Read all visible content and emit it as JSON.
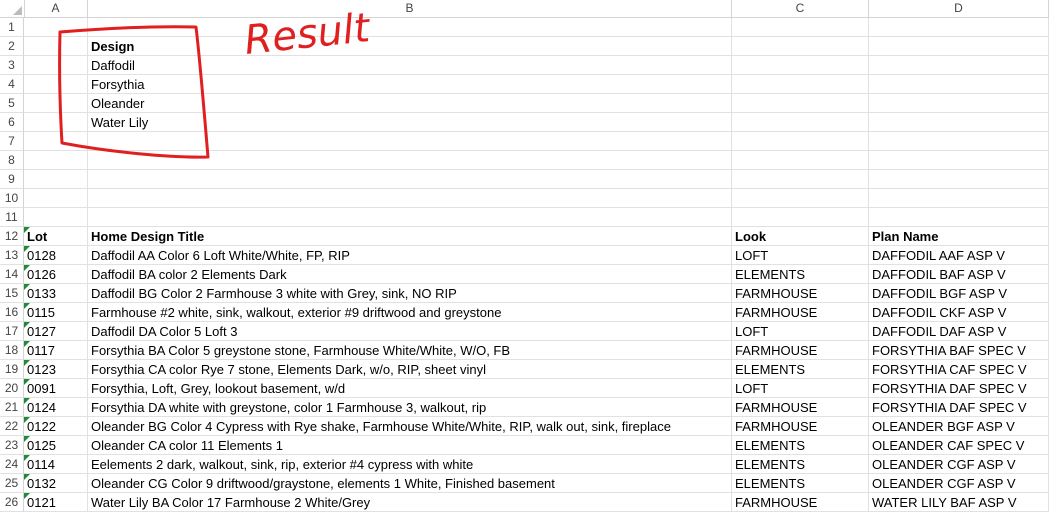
{
  "columns": [
    "A",
    "B",
    "C",
    "D"
  ],
  "annotation": {
    "text": "Result",
    "color": "#e02020"
  },
  "design_list": {
    "header": "Design",
    "items": [
      "Daffodil",
      "Forsythia",
      "Oleander",
      "Water Lily"
    ]
  },
  "table": {
    "headers": [
      "Lot",
      "Home Design Title",
      "Look",
      "Plan Name"
    ],
    "rows": [
      [
        "0128",
        "Daffodil AA Color 6 Loft White/White, FP, RIP",
        "LOFT",
        "DAFFODIL AAF ASP V"
      ],
      [
        "0126",
        "Daffodil BA color 2 Elements Dark",
        "ELEMENTS",
        "DAFFODIL BAF ASP V"
      ],
      [
        "0133",
        "Daffodil BG Color 2 Farmhouse 3 white with Grey, sink, NO RIP",
        "FARMHOUSE",
        "DAFFODIL BGF ASP V"
      ],
      [
        "0115",
        "Farmhouse #2 white, sink, walkout, exterior #9 driftwood and greystone",
        "FARMHOUSE",
        "DAFFODIL CKF ASP V"
      ],
      [
        "0127",
        "Daffodil DA Color 5 Loft 3",
        "LOFT",
        "DAFFODIL DAF ASP V"
      ],
      [
        "0117",
        "Forsythia BA Color 5 greystone stone, Farmhouse White/White, W/O, FB",
        "FARMHOUSE",
        "FORSYTHIA BAF SPEC V"
      ],
      [
        "0123",
        "Forsythia CA color Rye 7 stone, Elements Dark, w/o, RIP, sheet vinyl",
        "ELEMENTS",
        "FORSYTHIA CAF SPEC V"
      ],
      [
        "0091",
        "Forsythia, Loft, Grey, lookout basement, w/d",
        "LOFT",
        "FORSYTHIA DAF SPEC V"
      ],
      [
        "0124",
        "Forsythia DA  white with greystone, color 1 Farmhouse 3, walkout, rip",
        "FARMHOUSE",
        "FORSYTHIA DAF SPEC V"
      ],
      [
        "0122",
        "Oleander BG Color 4 Cypress with Rye shake, Farmhouse White/White, RIP, walk out, sink, fireplace",
        "FARMHOUSE",
        "OLEANDER BGF ASP V"
      ],
      [
        "0125",
        "Oleander CA color 11 Elements 1",
        "ELEMENTS",
        "OLEANDER CAF SPEC V"
      ],
      [
        "0114",
        "Eelements 2 dark, walkout, sink, rip, exterior #4 cypress with white",
        "ELEMENTS",
        "OLEANDER CGF ASP V"
      ],
      [
        "0132",
        "Oleander CG Color 9 driftwood/graystone, elements 1 White, Finished basement",
        "ELEMENTS",
        "OLEANDER CGF ASP V"
      ],
      [
        "0121",
        "Water Lily BA Color 17 Farmhouse 2 White/Grey",
        "FARMHOUSE",
        "WATER LILY BAF ASP V"
      ]
    ]
  },
  "row_numbers": [
    "1",
    "2",
    "3",
    "4",
    "5",
    "6",
    "7",
    "8",
    "9",
    "10",
    "11",
    "12",
    "13",
    "14",
    "15",
    "16",
    "17",
    "18",
    "19",
    "20",
    "21",
    "22",
    "23",
    "24",
    "25",
    "26"
  ]
}
